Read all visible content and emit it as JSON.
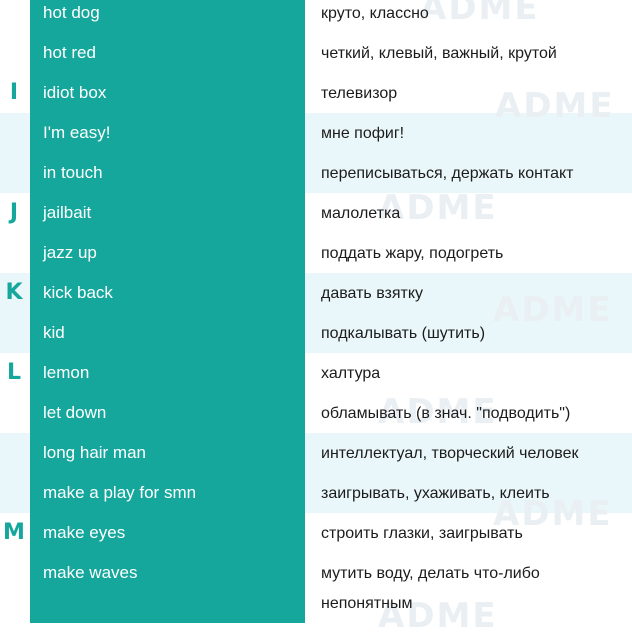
{
  "watermark": "ADME",
  "letters": [
    {
      "letter": "I"
    },
    {
      "letter": "J"
    },
    {
      "letter": "K"
    },
    {
      "letter": "L"
    },
    {
      "letter": "M"
    }
  ],
  "rows": [
    {
      "en": "hot dog",
      "ru": "круто, классно"
    },
    {
      "en": "hot red",
      "ru": "четкий, клевый, важный, крутой"
    },
    {
      "en": "idiot box",
      "ru": "телевизор"
    },
    {
      "en": "I'm easy!",
      "ru": "мне пофиг!"
    },
    {
      "en": "in touch",
      "ru": "переписываться, держать контакт"
    },
    {
      "en": "jailbait",
      "ru": "малолетка"
    },
    {
      "en": "jazz up",
      "ru": "поддать жару, подогреть"
    },
    {
      "en": "kick back",
      "ru": "давать взятку"
    },
    {
      "en": "kid",
      "ru": "подкалывать (шутить)"
    },
    {
      "en": "lemon",
      "ru": "халтура"
    },
    {
      "en": "let down",
      "ru": "обламывать (в знач. \"подводить\")"
    },
    {
      "en": "long hair man",
      "ru": "интеллектуал, творческий человек"
    },
    {
      "en": "make a play for smn",
      "ru": "заигрывать, ухаживать, клеить"
    },
    {
      "en": "make eyes",
      "ru": "строить глазки, заигрывать"
    },
    {
      "en": "make waves",
      "ru": "мутить воду, делать что-либо",
      "ru2": "непонятным"
    }
  ]
}
